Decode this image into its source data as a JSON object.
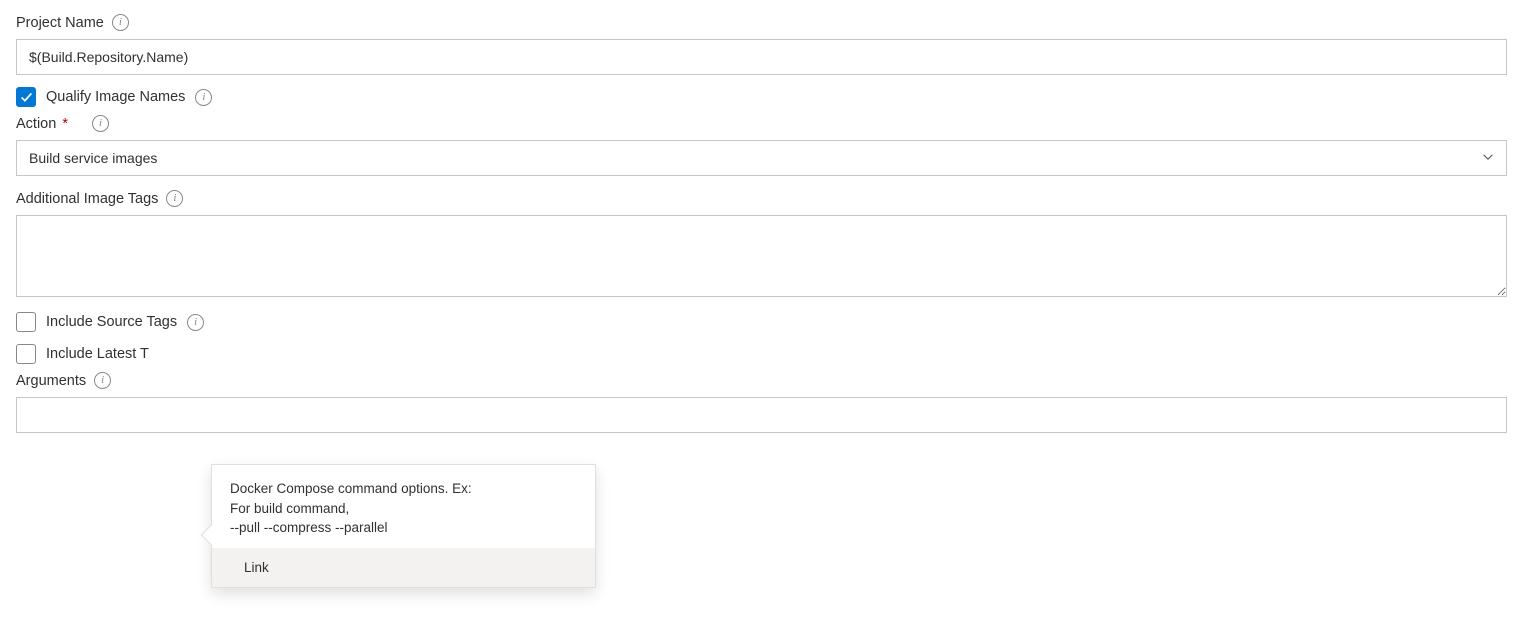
{
  "projectName": {
    "label": "Project Name",
    "value": "$(Build.Repository.Name)"
  },
  "qualifyImageNames": {
    "label": "Qualify Image Names",
    "checked": true
  },
  "action": {
    "label": "Action",
    "required": "*",
    "value": "Build service images"
  },
  "additionalImageTags": {
    "label": "Additional Image Tags",
    "value": ""
  },
  "includeSourceTags": {
    "label": "Include Source Tags",
    "checked": false
  },
  "includeLatestTag": {
    "label": "Include Latest T",
    "checked": false
  },
  "arguments": {
    "label": "Arguments",
    "value": ""
  },
  "tooltip": {
    "body": "Docker Compose command options. Ex:\nFor build command,\n--pull --compress --parallel",
    "link": "Link"
  }
}
